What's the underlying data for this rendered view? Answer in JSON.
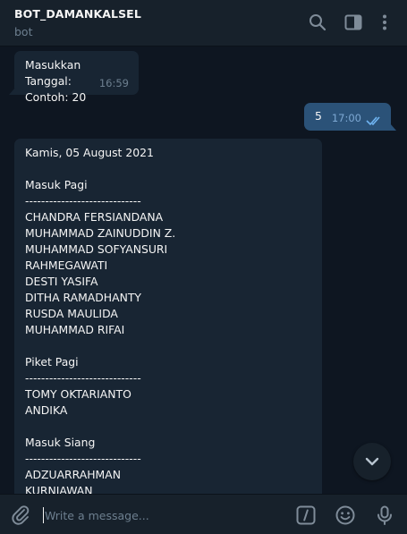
{
  "header": {
    "title": "BOT_DAMANKALSEL",
    "subtitle": "bot"
  },
  "messages": {
    "incoming_1": {
      "lines": [
        "Masukkan Tanggal:",
        "Contoh: 20"
      ],
      "time": "16:59"
    },
    "outgoing_1": {
      "text": "5",
      "time": "17:00"
    },
    "incoming_2": {
      "lines": [
        "Kamis, 05 August 2021",
        "",
        "Masuk Pagi",
        "-----------------------------",
        "CHANDRA FERSIANDANA",
        "MUHAMMAD ZAINUDDIN Z.",
        "MUHAMMAD SOFYANSURI",
        "RAHMEGAWATI",
        "DESTI YASIFA",
        "DITHA RAMADHANTY",
        "RUSDA MAULIDA",
        "MUHAMMAD RIFAI",
        "",
        "Piket Pagi",
        "-----------------------------",
        "TOMY OKTARIANTO",
        "ANDIKA",
        "",
        "Masuk Siang",
        "-----------------------------",
        "ADZUARRAHMAN",
        "KURNIAWAN"
      ]
    }
  },
  "composer": {
    "placeholder": "Write a message..."
  },
  "colors": {
    "background": "#0e1621",
    "panel": "#17212b",
    "incoming_bubble": "#182533",
    "outgoing_bubble": "#2b5278",
    "muted_text": "#6d7f8f",
    "accent": "#4fa3e8"
  }
}
